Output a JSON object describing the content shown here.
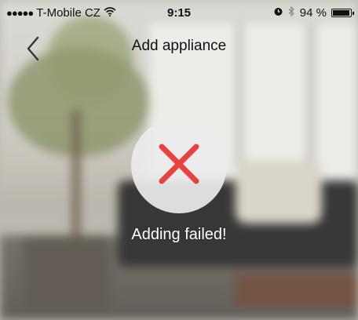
{
  "status_bar": {
    "signal_dots": "●●●●●",
    "carrier": "T-Mobile CZ",
    "time": "9:15",
    "battery_text": "94 %",
    "battery_level": 0.94,
    "icons": [
      "wifi-icon",
      "alarm-icon",
      "bluetooth-icon",
      "battery-icon"
    ]
  },
  "nav": {
    "title": "Add appliance",
    "back_icon": "chevron-left-icon"
  },
  "result": {
    "icon": "close-icon",
    "icon_color": "#e8423f",
    "message": "Adding failed!"
  }
}
